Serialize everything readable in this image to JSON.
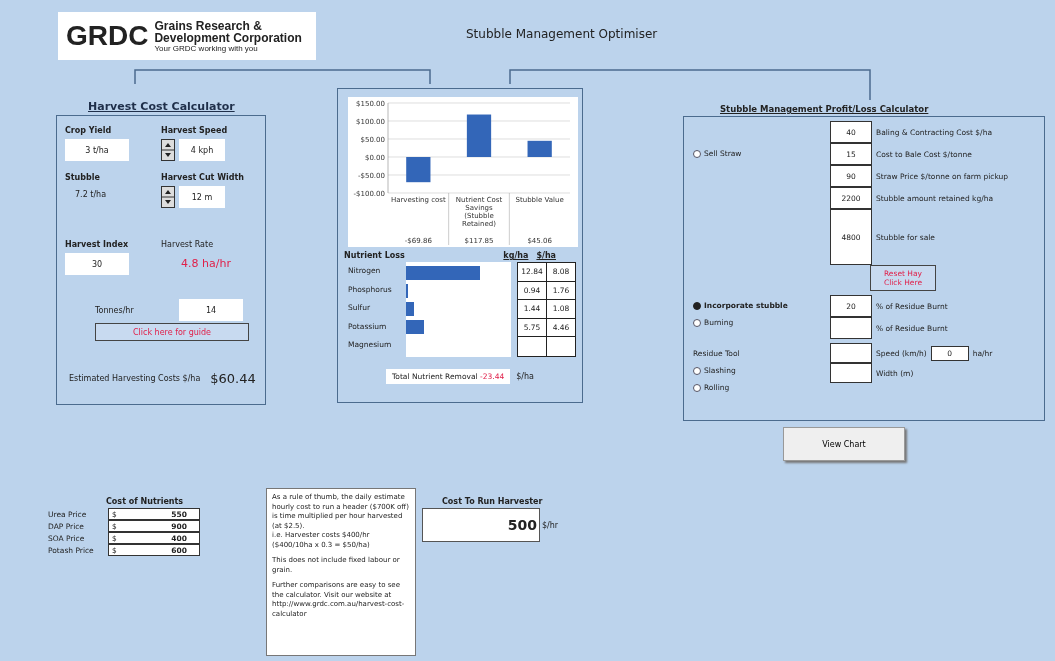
{
  "logo": {
    "mark": "GRDC",
    "lines": [
      "Grains Research &",
      "Development Corporation"
    ],
    "tagline": "Your GRDC working with you"
  },
  "title": "Stubble Management Optimiser",
  "harvest": {
    "heading": "Harvest Cost Calculator",
    "crop_yield": {
      "label": "Crop Yield",
      "value": "3 t/ha"
    },
    "harvest_speed": {
      "label": "Harvest Speed",
      "value": "4 kph"
    },
    "stubble": {
      "label": "Stubble",
      "value": "7.2 t/ha"
    },
    "cut_width": {
      "label": "Harvest Cut Width",
      "value": "12 m"
    },
    "harvest_index": {
      "label": "Harvest Index",
      "value": "30"
    },
    "harvest_rate": {
      "label": "Harvest Rate",
      "value": "4.8",
      "unit": "ha/hr"
    },
    "tonnes": {
      "label": "Tonnes/hr",
      "value": "14"
    },
    "guide_button": "Click here for guide",
    "cost": {
      "label": "Estimated Harvesting Costs $/ha",
      "value": "$60.44"
    }
  },
  "chart_data": {
    "type": "bar",
    "grid": true,
    "categories": [
      "Harvesting cost",
      "Nutrient Cost Savings (Stubble Retained)",
      "Stubble Value"
    ],
    "value_labels": [
      "-$69.86",
      "$117.85",
      "$45.06"
    ],
    "series": [
      {
        "color": "#3366b8",
        "values": [
          -70,
          118,
          45
        ]
      }
    ],
    "ylim": [
      -100,
      150
    ],
    "yticks": [
      {
        "value": -100,
        "label": "-$100.00"
      },
      {
        "value": -50,
        "label": "-$50.00"
      },
      {
        "value": 0,
        "label": "$0.00"
      },
      {
        "value": 50,
        "label": "$50.00"
      },
      {
        "value": 100,
        "label": "$100.00"
      },
      {
        "value": 150,
        "label": "$150.00"
      }
    ]
  },
  "nutrients": {
    "heading": "Nutrient Loss",
    "columns": [
      "kg/ha",
      "$/ha"
    ],
    "rows": [
      {
        "name": "Nitrogen",
        "level": 0.7,
        "kg": "12.84",
        "cost": "8.08"
      },
      {
        "name": "Phosphorus",
        "level": 0.02,
        "kg": "0.94",
        "cost": "1.76"
      },
      {
        "name": "Sulfur",
        "level": 0.08,
        "kg": "1.44",
        "cost": "1.08"
      },
      {
        "name": "Potassium",
        "level": 0.17,
        "kg": "5.75",
        "cost": "4.46"
      },
      {
        "name": "Magnesium"
      }
    ],
    "total": {
      "label": "Total Nutrient Removal",
      "value": "-23.44",
      "unit": "$/ha"
    }
  },
  "profit": {
    "heading": "Stubble Management Profit/Loss Calculator",
    "sell": {
      "label": "Sell Straw",
      "selected": false
    },
    "fields": [
      {
        "value": "40",
        "label": "Baling & Contracting Cost $/ha"
      },
      {
        "value": "15",
        "label": "Cost to Bale Cost $/tonne"
      },
      {
        "value": "90",
        "label": "Straw Price $/tonne on farm pickup"
      },
      {
        "value": "2200",
        "label": "Stubble amount retained kg/ha"
      },
      {
        "value": "4800",
        "label": "Stubble for sale"
      }
    ],
    "reset_button": [
      "Reset Hay",
      "Click Here"
    ],
    "burn_options": [
      {
        "label": "Incorporate stubble",
        "selected": true
      },
      {
        "label": "Burning",
        "selected": false
      }
    ],
    "burn_fields": [
      {
        "value": "20",
        "label": "% of Residue Burnt"
      },
      {
        "label": "% of Residue Burnt"
      }
    ],
    "tool_label": "Residue Tool",
    "tool_options": [
      {
        "label": "Slashing",
        "selected": false
      },
      {
        "label": "Rolling",
        "selected": false
      }
    ],
    "speed_label": "Speed (km/h)",
    "speed_value": "0",
    "speed_unit": "ha/hr",
    "width_label": "Width (m)",
    "view_button": "View Chart"
  },
  "nutrient_costs": {
    "heading": "Cost of Nutrients",
    "rows": [
      {
        "name": "Urea Price",
        "currency": "$",
        "value": "550"
      },
      {
        "name": "DAP Price",
        "currency": "$",
        "value": "900"
      },
      {
        "name": "SOA Price",
        "currency": "$",
        "value": "400"
      },
      {
        "name": "Potash Price",
        "currency": "$",
        "value": "600"
      }
    ]
  },
  "note": [
    "As a rule of thumb, the daily estimate hourly cost to run a header ($700K off) is time multiplied per hour harvested (at $2.5).",
    "i.e. Harvester costs $400/hr",
    "($400/10ha x 0.3 = $50/ha)",
    "This does not include fixed labour or grain.",
    "Further comparisons are easy to see the calculator. Visit our website at http://www.grdc.com.au/harvest-cost-calculator"
  ],
  "run_cost": {
    "heading": "Cost To Run Harvester",
    "value": "500",
    "unit": "$/hr"
  }
}
